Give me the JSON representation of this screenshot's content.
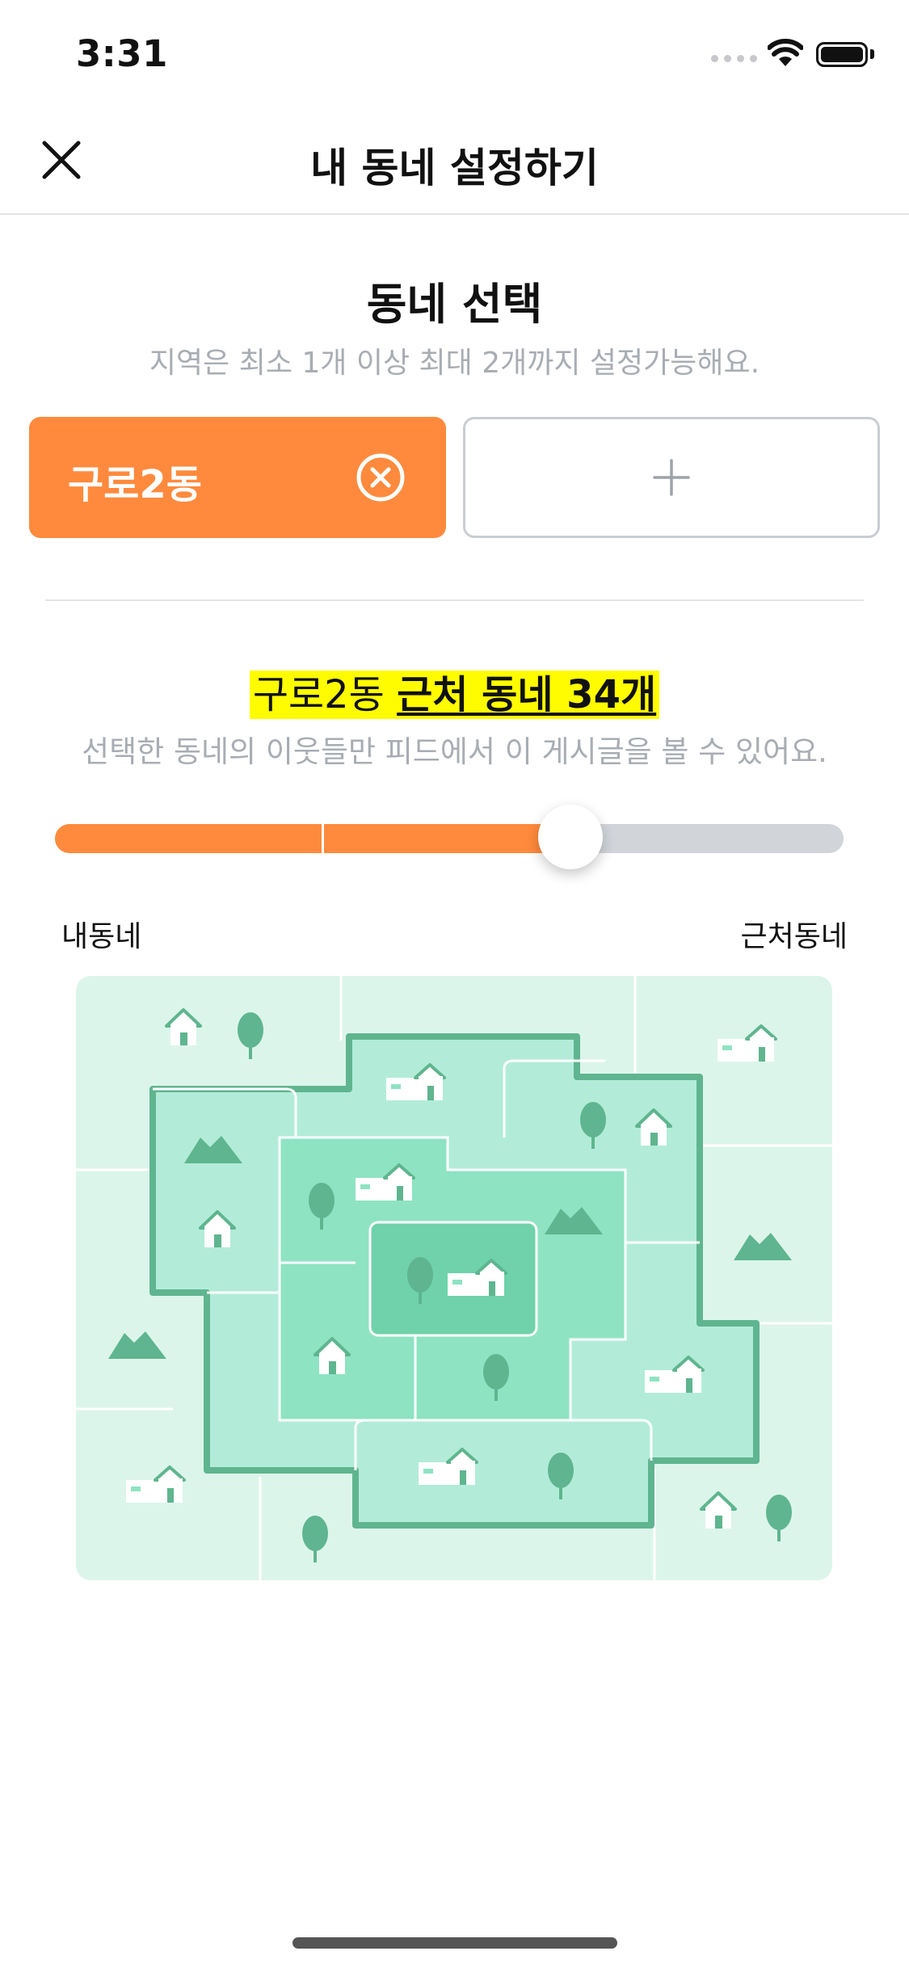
{
  "status_bar": {
    "time": "3:31"
  },
  "navbar": {
    "title": "내 동네 설정하기",
    "close_icon": "close-icon"
  },
  "neighborhood_select": {
    "title": "동네 선택",
    "subtitle": "지역은 최소 1개 이상 최대 2개까지 설정가능해요.",
    "selected": {
      "name": "구로2동",
      "remove_icon": "remove-circle-icon"
    },
    "add_icon": "plus-icon"
  },
  "range": {
    "heading_prefix": "구로2동",
    "heading_highlight": "근처 동네 34개",
    "subtitle": "선택한 동네의 이웃들만 피드에서 이 게시글을 볼 수 있어요.",
    "slider_value_fraction": 0.654,
    "label_min": "내동네",
    "label_max": "근처동네"
  },
  "colors": {
    "accent": "#ff8a3d",
    "highlight": "#fffc00",
    "map_outer": "#dcf5ea",
    "map_ring1": "#b2ecd8",
    "map_ring2": "#8ee3c3",
    "map_center": "#6fd2ab",
    "map_border": "#5fb58f"
  }
}
